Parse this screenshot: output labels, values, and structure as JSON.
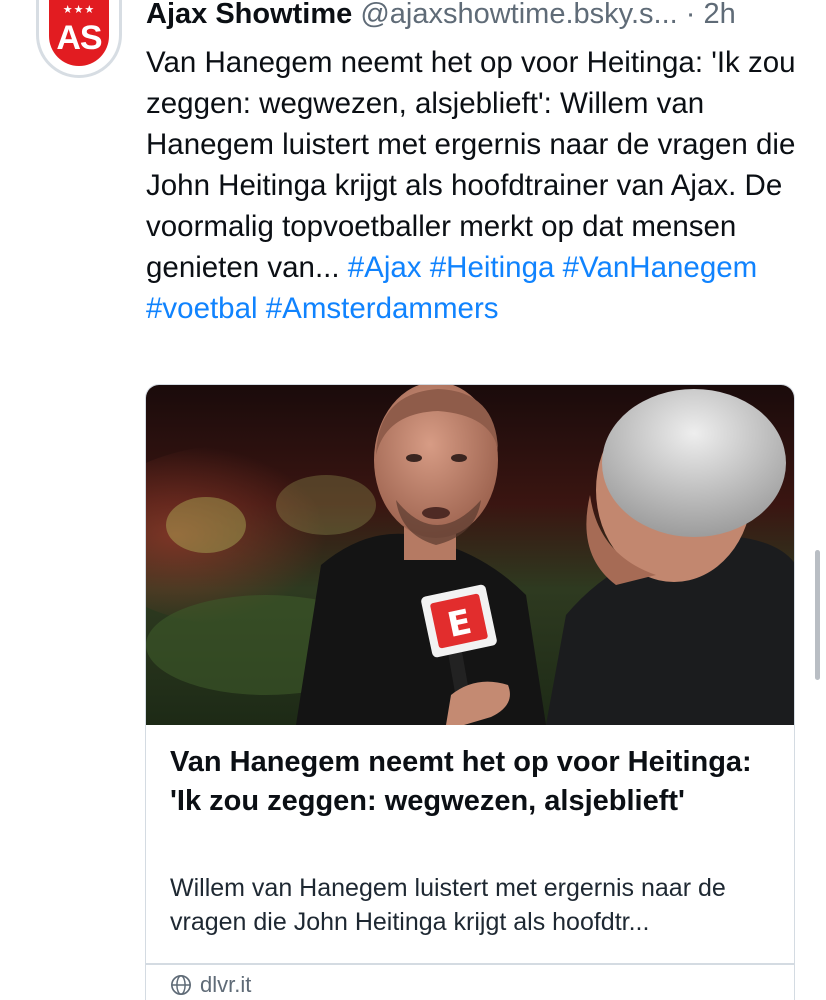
{
  "post": {
    "author": {
      "display_name": "Ajax Showtime",
      "handle": "@ajaxshowtime.bsky.s...",
      "avatar_letters": "AS",
      "avatar_stars": "★★★"
    },
    "separator": "·",
    "time": "2h",
    "text": "Van Hanegem neemt het op voor Heitinga: 'Ik zou zeggen: wegwezen, alsjeblieft': Willem van Hanegem luistert met ergernis naar de vragen die John Heitinga krijgt als hoofdtrainer van Ajax. De voormalig topvoetballer merkt op dat mensen genieten van...",
    "hashtags": [
      "#Ajax",
      "#Heitinga",
      "#VanHanegem",
      "#voetbal",
      "#Amsterdammers"
    ]
  },
  "link_card": {
    "title": "Van Hanegem neemt het op voor Heitinga: 'Ik zou zeggen: wegwezen, alsjeblieft'",
    "description": "Willem van Hanegem luistert met ergernis naar de vragen die John Heitinga krijgt als hoofdtr...",
    "domain": "dlvr.it",
    "domain_icon": "globe-icon",
    "image_mic_logo": "E"
  },
  "colors": {
    "hashtag": "#1083fe",
    "avatar_red": "#e21c21",
    "muted_text": "#5f6b77"
  }
}
